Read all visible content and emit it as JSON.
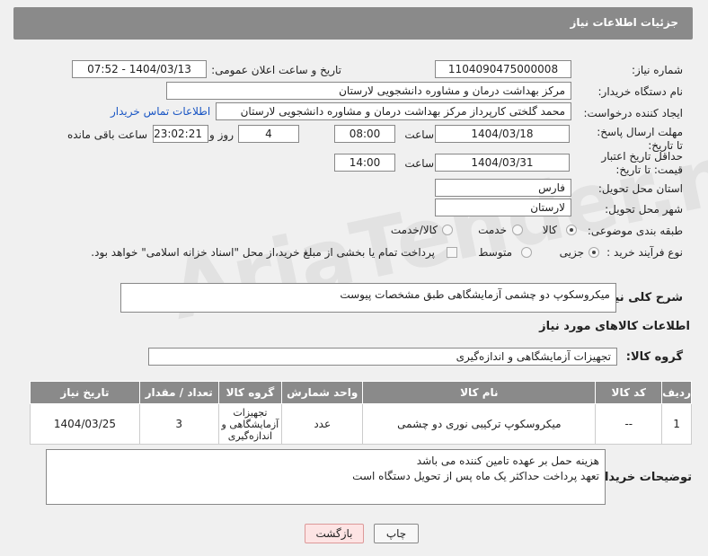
{
  "header": {
    "title": "جزئیات اطلاعات نیاز"
  },
  "fields": {
    "need_number_label": "شماره نیاز:",
    "need_number": "1104090475000008",
    "announce_label": "تاریخ و ساعت اعلان عمومی:",
    "announce_value": "1404/03/13 - 07:52",
    "buyer_org_label": "نام دستگاه خریدار:",
    "buyer_org": "مرکز بهداشت  درمان و مشاوره دانشجویی لارستان",
    "requester_label": "ایجاد کننده درخواست:",
    "requester": "محمد گلختی کارپرداز مرکز بهداشت  درمان و مشاوره دانشجویی لارستان",
    "contact_link": "اطلاعات تماس خریدار",
    "deadline_label": "مهلت ارسال پاسخ: تا تاریخ:",
    "deadline_date": "1404/03/18",
    "time_label": "ساعت",
    "deadline_time": "08:00",
    "days": "4",
    "days_label": "روز و",
    "remaining_time": "23:02:21",
    "remaining_label": "ساعت باقی مانده",
    "price_valid_label": "حداقل تاریخ اعتبار قیمت: تا تاریخ:",
    "price_valid_date": "1404/03/31",
    "price_valid_time": "14:00",
    "province_label": "استان محل تحویل:",
    "province": "فارس",
    "city_label": "شهر محل تحویل:",
    "city": "لارستان",
    "category_label": "طبقه بندی موضوعی:",
    "category_options": [
      "کالا",
      "خدمت",
      "کالا/خدمت"
    ],
    "process_label": "نوع فرآیند خرید :",
    "process_options": [
      "جزیی",
      "متوسط"
    ],
    "payment_note": "پرداخت تمام یا بخشی از مبلغ خرید،از محل \"اسناد خزانه اسلامی\" خواهد بود."
  },
  "description": {
    "label": "شرح کلی نیاز:",
    "value": "میکروسکوپ دو چشمی آزمایشگاهی طبق مشخصات پیوست"
  },
  "goods_section": {
    "title": "اطلاعات کالاهای مورد نیاز",
    "group_label": "گروه کالا:",
    "group_value": "تجهیزات آزمایشگاهی و اندازه‌گیری"
  },
  "table": {
    "headers": [
      "ردیف",
      "کد کالا",
      "نام کالا",
      "واحد شمارش",
      "گروه کالا",
      "تعداد / مقدار",
      "تاریخ نیاز"
    ],
    "rows": [
      [
        "1",
        "--",
        "میکروسکوپ ترکیبی نوری دو چشمی",
        "عدد",
        "تجهیزات آزمایشگاهی و اندازه‌گیری",
        "3",
        "1404/03/25"
      ]
    ]
  },
  "buyer_notes": {
    "label": "توضیحات خریدار:",
    "line1": "هزینه حمل بر عهده تامین کننده می باشد",
    "line2": "تعهد پرداخت حداکثر یک ماه پس از تحویل دستگاه است"
  },
  "buttons": {
    "print": "چاپ",
    "back": "بازگشت"
  },
  "watermark": "AriaTender.net"
}
